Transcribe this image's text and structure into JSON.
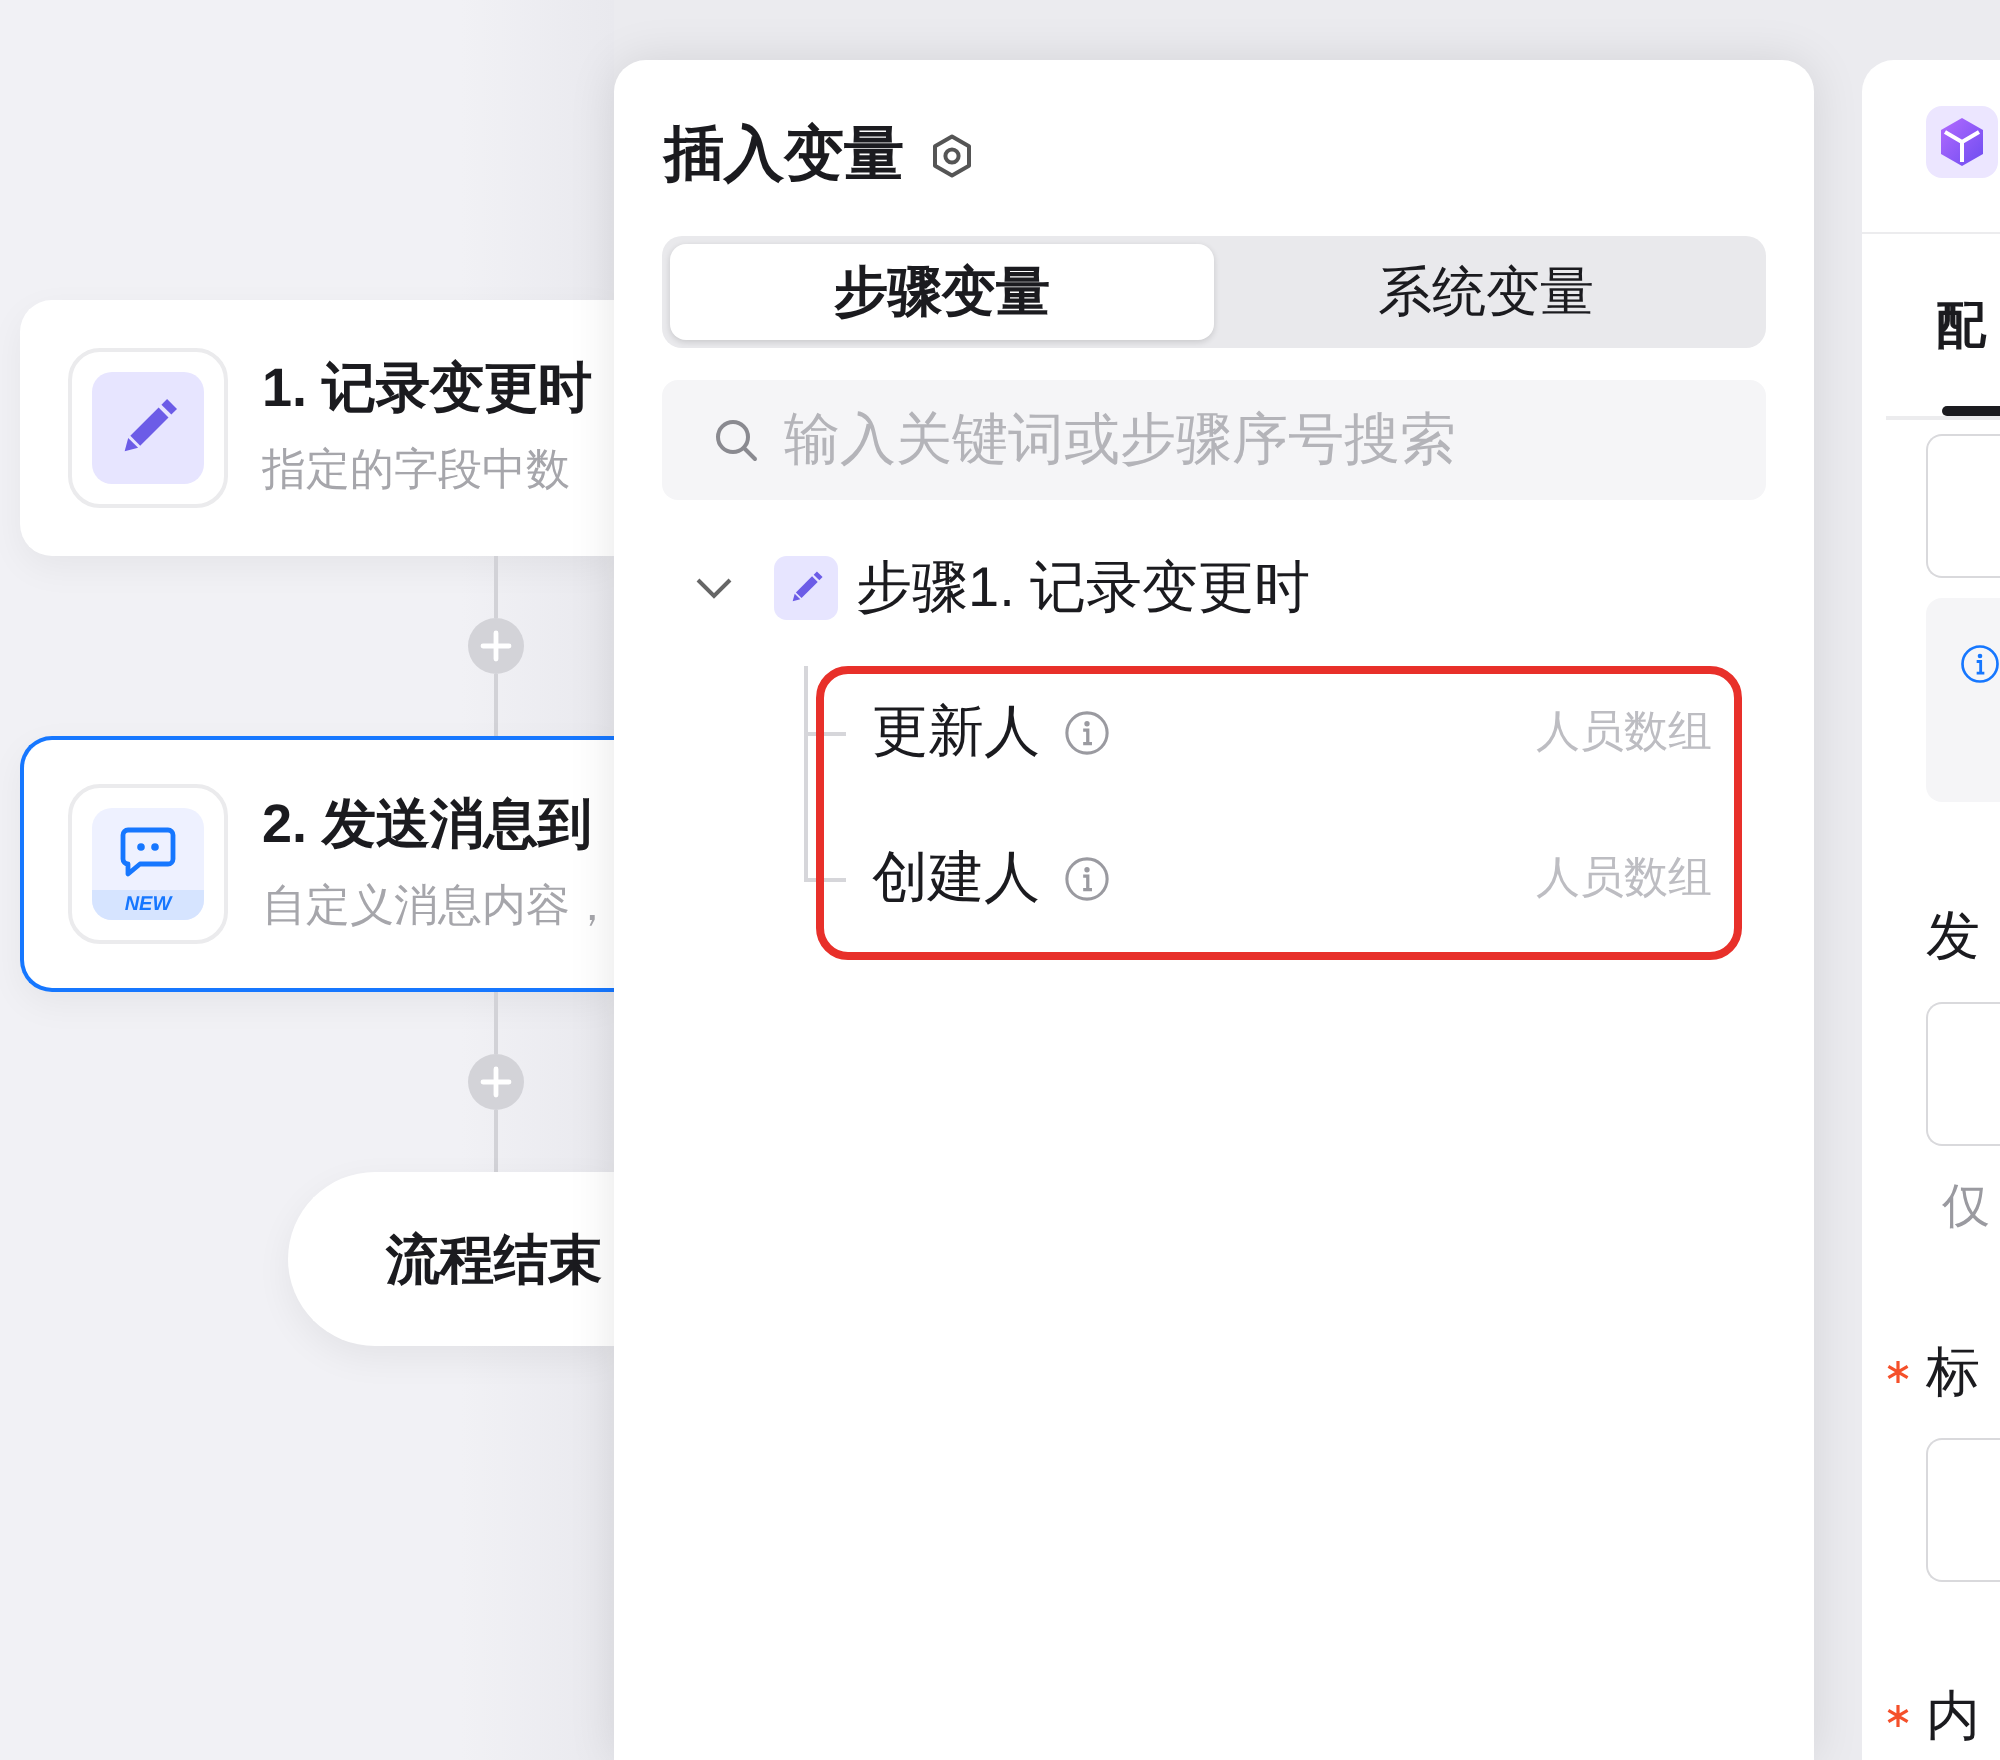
{
  "canvas": {
    "nodes": [
      {
        "kind": "trigger",
        "title": "1. 记录变更时",
        "description": "指定的字段中数",
        "selected": false
      },
      {
        "kind": "message",
        "title": "2. 发送消息到",
        "description": "自定义消息内容，",
        "badge": "NEW",
        "selected": true
      },
      {
        "kind": "end",
        "title": "流程结束",
        "selected": false
      }
    ]
  },
  "variable_panel": {
    "title": "插入变量",
    "tabs": [
      {
        "label": "步骤变量",
        "selected": true
      },
      {
        "label": "系统变量",
        "selected": false
      }
    ],
    "search": {
      "placeholder": "输入关键词或步骤序号搜索"
    },
    "tree": [
      {
        "label": "步骤1. 记录变更时",
        "expanded": true,
        "children_highlighted": true,
        "children": [
          {
            "label": "更新人",
            "type": "人员数组"
          },
          {
            "label": "创建人",
            "type": "人员数组"
          }
        ]
      }
    ]
  },
  "config_panel": {
    "tabs": [
      {
        "label": "配",
        "selected": true
      }
    ],
    "items": [
      {
        "kind": "input"
      },
      {
        "kind": "notice"
      },
      {
        "kind": "label",
        "text": "发",
        "required": false
      },
      {
        "kind": "input"
      },
      {
        "kind": "hint",
        "text": "仅"
      },
      {
        "kind": "label",
        "text": "标",
        "required": true
      },
      {
        "kind": "input"
      },
      {
        "kind": "label",
        "text": "内",
        "required": true
      }
    ]
  }
}
